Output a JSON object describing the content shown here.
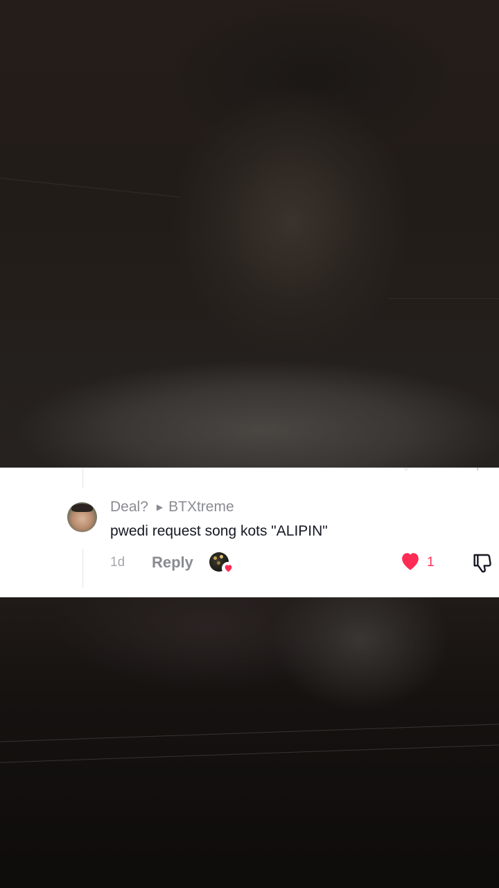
{
  "comment": {
    "username": "Deal?",
    "reply_to": "BTXtreme",
    "text": "pwedi request song kots \"ALIPIN\"",
    "time": "1d",
    "reply_label": "Reply",
    "like_count": "1",
    "liked": true
  },
  "colors": {
    "like": "#fe2c55",
    "muted_text": "#8a8b91",
    "primary_text": "#161823"
  },
  "icons": {
    "like": "heart-icon",
    "dislike": "thumbs-down-icon",
    "reply_arrow": "caret-right-icon",
    "creator_liked": "creator-liked-badge-icon"
  }
}
